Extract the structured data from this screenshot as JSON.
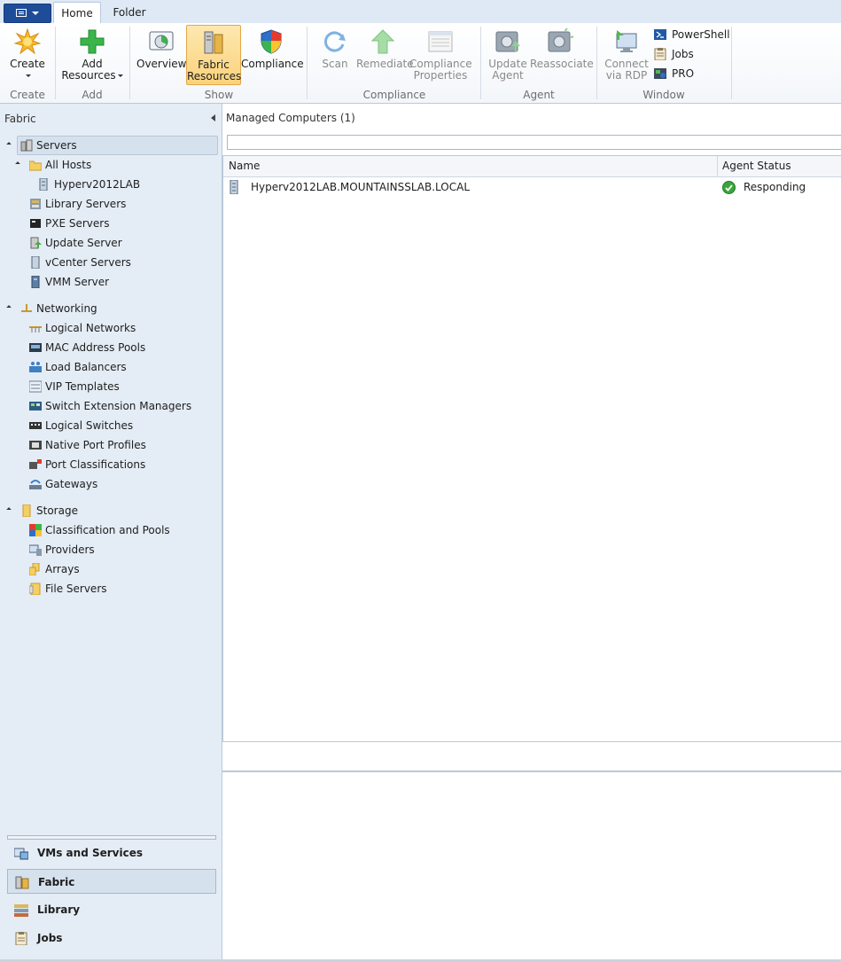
{
  "tabs": {
    "home": "Home",
    "folder": "Folder"
  },
  "ribbon": {
    "groups": {
      "create": "Create",
      "add": "Add",
      "show": "Show",
      "compliance": "Compliance",
      "agent": "Agent",
      "window": "Window"
    },
    "buttons": {
      "create": "Create",
      "add_resources": "Add Resources",
      "overview": "Overview",
      "fabric_resources_line1": "Fabric",
      "fabric_resources_line2": "Resources",
      "compliance": "Compliance",
      "scan": "Scan",
      "remediate": "Remediate",
      "compliance_properties_line1": "Compliance",
      "compliance_properties_line2": "Properties",
      "update_agent_line1": "Update",
      "update_agent_line2": "Agent",
      "reassociate": "Reassociate",
      "connect_rdp_line1": "Connect",
      "connect_rdp_line2": "via RDP",
      "powershell": "PowerShell",
      "jobs": "Jobs",
      "pro": "PRO"
    }
  },
  "nav": {
    "header": "Fabric",
    "servers": "Servers",
    "all_hosts": "All Hosts",
    "host": "Hyperv2012LAB",
    "library_servers": "Library Servers",
    "pxe_servers": "PXE Servers",
    "update_server": "Update Server",
    "vcenter_servers": "vCenter Servers",
    "vmm_server": "VMM Server",
    "networking": "Networking",
    "logical_networks": "Logical Networks",
    "mac_pools": "MAC Address Pools",
    "load_balancers": "Load Balancers",
    "vip_templates": "VIP Templates",
    "switch_ext": "Switch Extension Managers",
    "logical_switches": "Logical Switches",
    "native_port_profiles": "Native Port Profiles",
    "port_classifications": "Port Classifications",
    "gateways": "Gateways",
    "storage": "Storage",
    "class_pools": "Classification and Pools",
    "providers": "Providers",
    "arrays": "Arrays",
    "file_servers": "File Servers"
  },
  "wunderbar": {
    "vms": "VMs and Services",
    "fabric": "Fabric",
    "library": "Library",
    "jobs": "Jobs"
  },
  "main": {
    "title": "Managed Computers (1)",
    "search_value": "",
    "columns": {
      "name": "Name",
      "agent_status": "Agent Status"
    },
    "rows": [
      {
        "name": "Hyperv2012LAB.MOUNTAINSSLAB.LOCAL",
        "status": "Responding"
      }
    ]
  },
  "colors": {
    "accent": "#1f4c99",
    "selected_ribbon": "#fbd27a",
    "nav_bg": "#e4ecf5",
    "status_ok": "#3aa63a"
  }
}
